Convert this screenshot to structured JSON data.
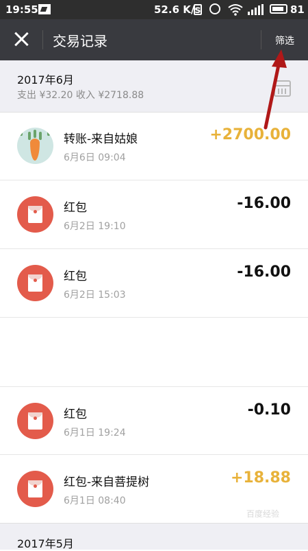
{
  "status_bar": {
    "time": "19:55",
    "speed": "52.6 K/s",
    "battery": "81"
  },
  "header": {
    "title": "交易记录",
    "filter_label": "筛选"
  },
  "months": [
    {
      "title": "2017年6月",
      "summary": "支出 ¥32.20 收入 ¥2718.88"
    },
    {
      "title": "2017年5月",
      "summary": ""
    }
  ],
  "transactions": [
    {
      "name": "转账-来自姑娘",
      "date": "6月6日 09:04",
      "amount": "+2700.00",
      "icon": "carrot-avatar"
    },
    {
      "name": "红包",
      "date": "6月2日 19:10",
      "amount": "-16.00",
      "icon": "red-packet-icon"
    },
    {
      "name": "红包",
      "date": "6月2日 15:03",
      "amount": "-16.00",
      "icon": "red-packet-icon"
    },
    {
      "name": "红包",
      "date": "6月1日 19:24",
      "amount": "-0.10",
      "icon": "red-packet-icon"
    },
    {
      "name": "红包-来自菩提树",
      "date": "6月1日 08:40",
      "amount": "+18.88",
      "icon": "red-packet-icon"
    }
  ],
  "colors": {
    "income": "#e8b23a",
    "expense": "#111111",
    "red_packet": "#e35b4b",
    "annotation_arrow": "#b01818"
  },
  "watermark": "百度经验"
}
